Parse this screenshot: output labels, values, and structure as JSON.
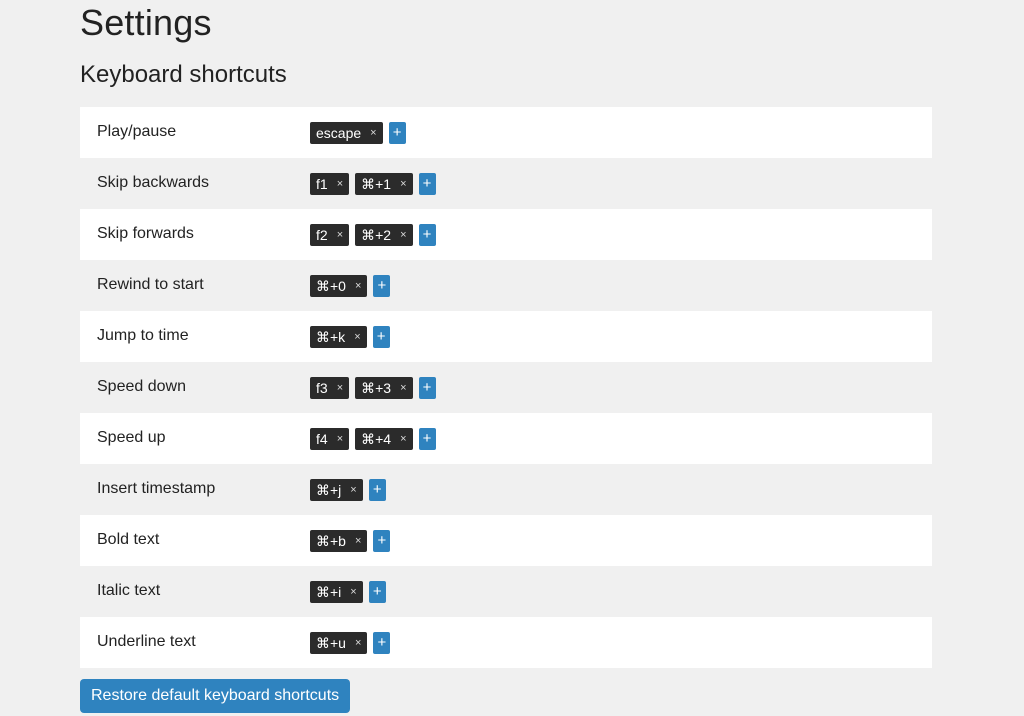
{
  "page": {
    "title": "Settings",
    "section_title": "Keyboard shortcuts"
  },
  "shortcuts": [
    {
      "label": "Play/pause",
      "keys": [
        "escape"
      ]
    },
    {
      "label": "Skip backwards",
      "keys": [
        "f1",
        "⌘+1"
      ]
    },
    {
      "label": "Skip forwards",
      "keys": [
        "f2",
        "⌘+2"
      ]
    },
    {
      "label": "Rewind to start",
      "keys": [
        "⌘+0"
      ]
    },
    {
      "label": "Jump to time",
      "keys": [
        "⌘+k"
      ]
    },
    {
      "label": "Speed down",
      "keys": [
        "f3",
        "⌘+3"
      ]
    },
    {
      "label": "Speed up",
      "keys": [
        "f4",
        "⌘+4"
      ]
    },
    {
      "label": "Insert timestamp",
      "keys": [
        "⌘+j"
      ]
    },
    {
      "label": "Bold text",
      "keys": [
        "⌘+b"
      ]
    },
    {
      "label": "Italic text",
      "keys": [
        "⌘+i"
      ]
    },
    {
      "label": "Underline text",
      "keys": [
        "⌘+u"
      ]
    }
  ],
  "icons": {
    "remove_glyph": "×",
    "add_glyph": "+"
  },
  "colors": {
    "accent": "#2f83bf",
    "chip_background": "#2b2b2b",
    "page_background": "#f0f0f0",
    "stripe_background": "#ffffff"
  },
  "restore_button": {
    "label": "Restore default keyboard shortcuts"
  }
}
